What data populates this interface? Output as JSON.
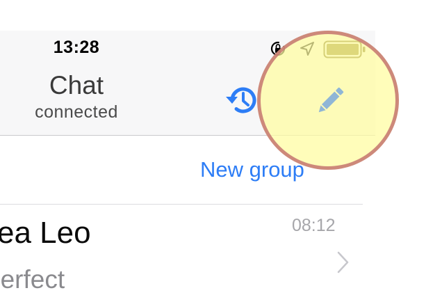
{
  "status_bar": {
    "time": "13:28",
    "icons": [
      "orientation-lock-icon",
      "location-icon",
      "battery-icon"
    ]
  },
  "header": {
    "title": "Chat",
    "subtitle": "connected",
    "actions": [
      "history-icon",
      "compose-pencil-icon"
    ]
  },
  "new_group_label": "New group",
  "chat_row": {
    "name": "ea Leo",
    "time": "08:12",
    "preview": "perfect"
  },
  "colors": {
    "accent": "#2d7df6",
    "pencil": "#8fb6d6",
    "highlight_fill": "#fffca0",
    "highlight_ring": "#c47670",
    "battery": "#8a7a1e"
  }
}
